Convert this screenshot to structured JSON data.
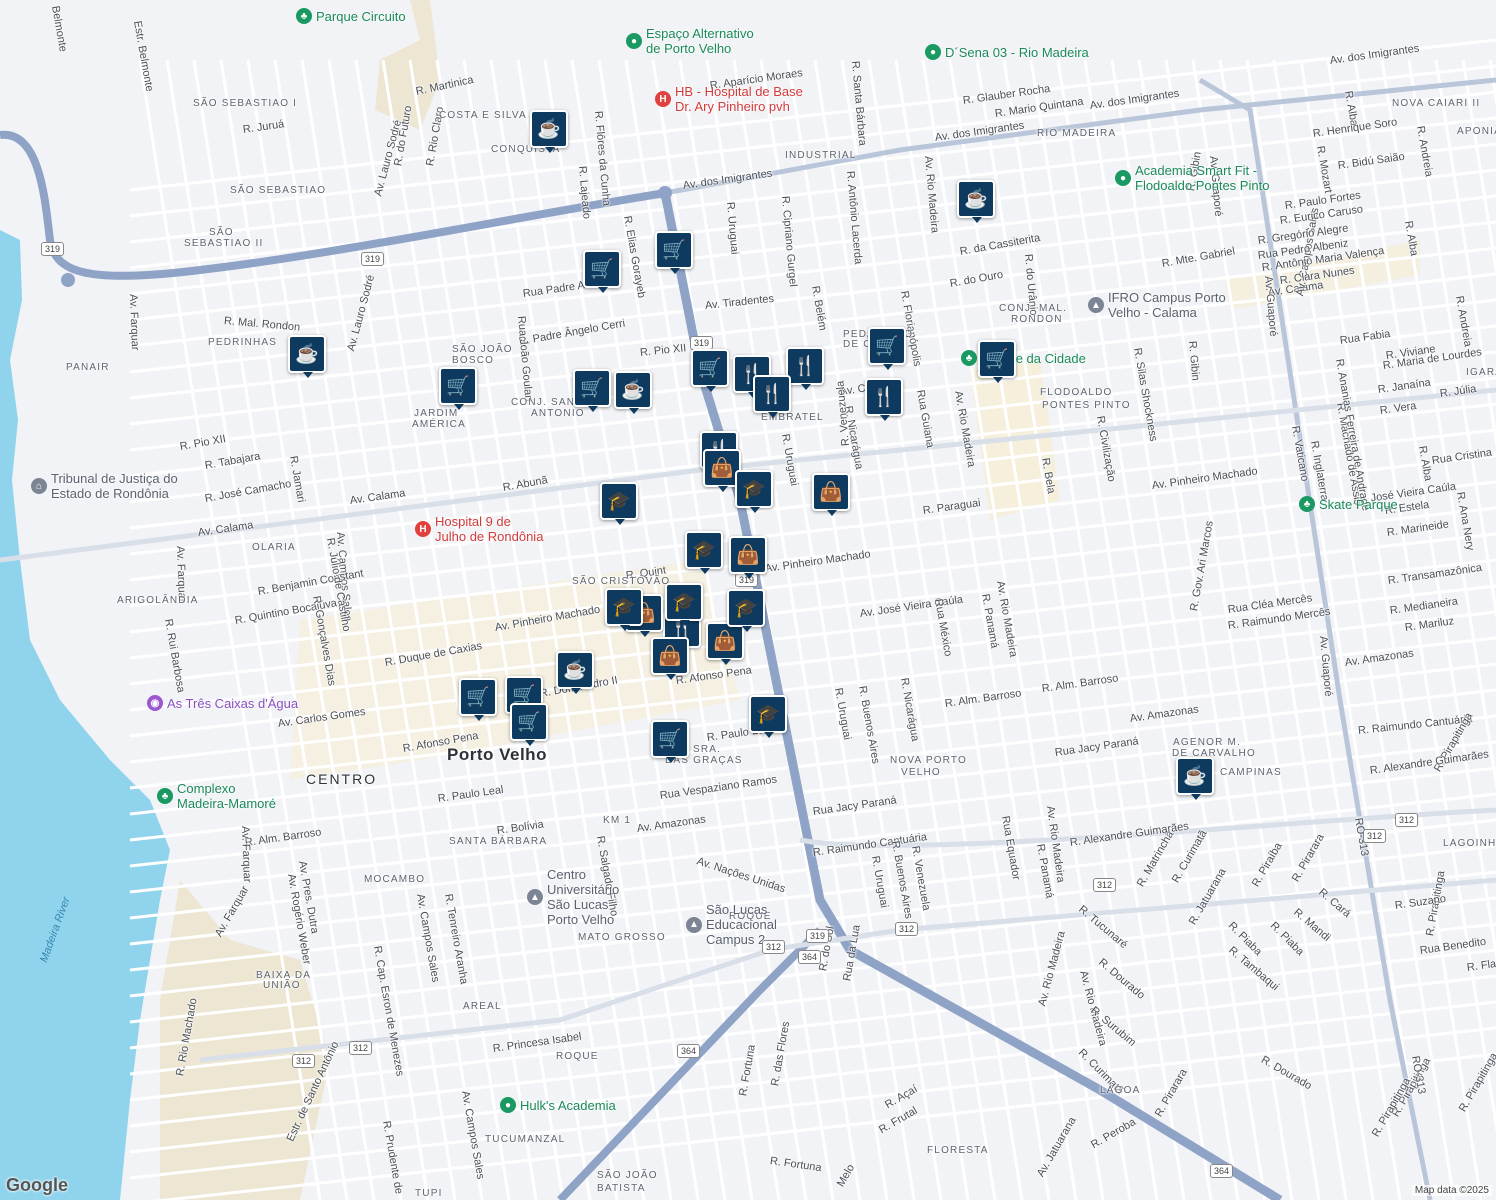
{
  "colors": {
    "background": "#f2f3f6",
    "water": "#8fd3ec",
    "main_road": "#8ea3c6",
    "marker": "#0e3a5f",
    "poi_green": "#1a9a62",
    "poi_red": "#e0413f"
  },
  "streets": [
    {
      "name": "Av. dos Imigrantes"
    },
    {
      "name": "Av. dos Imigrantes"
    },
    {
      "name": "Av. dos Imigrantes"
    },
    {
      "name": "Av. dos Imigrantes"
    },
    {
      "name": "Av. Tiradentes"
    },
    {
      "name": "Av. Calama"
    },
    {
      "name": "Av. Calama"
    },
    {
      "name": "Av. Calama"
    },
    {
      "name": "Av. Calama"
    },
    {
      "name": "Av. Pinheiro Machado"
    },
    {
      "name": "Av. Pinheiro Machado"
    },
    {
      "name": "Av. Pinheiro Machado"
    },
    {
      "name": "Av. José Vieira Caúla"
    },
    {
      "name": "Av. José Vieira Caúla"
    },
    {
      "name": "Av. Amazonas"
    },
    {
      "name": "Av. Amazonas"
    },
    {
      "name": "Av. Amazonas"
    },
    {
      "name": "Av. Carlos Gomes"
    },
    {
      "name": "Av. Nações Unidas"
    },
    {
      "name": "R. Raimundo Cantuária"
    },
    {
      "name": "R. Raimundo Cantuária"
    },
    {
      "name": "R. Alm. Barroso"
    },
    {
      "name": "R. Alm. Barroso"
    },
    {
      "name": "R. Alm. Barroso"
    },
    {
      "name": "Av. Farquar"
    },
    {
      "name": "Av. Farquar"
    },
    {
      "name": "Av. Farquar"
    },
    {
      "name": "Av. Farquar"
    },
    {
      "name": "Av. Lauro Sodré"
    },
    {
      "name": "Av. Lauro Sodré"
    },
    {
      "name": "Av. Campos Sales"
    },
    {
      "name": "Av. Campos Sales"
    },
    {
      "name": "Av. Campos Sales"
    },
    {
      "name": "Av. Rio Madeira"
    },
    {
      "name": "Av. Rio Madeira"
    },
    {
      "name": "Av. Rio Madeira"
    },
    {
      "name": "Av. Rio Madeira"
    },
    {
      "name": "Av. Rio Madeira"
    },
    {
      "name": "Av. Rio Madeira"
    },
    {
      "name": "Av. Guaporé"
    },
    {
      "name": "Av. Guaporé"
    },
    {
      "name": "Av. Guaporé"
    },
    {
      "name": "R. Abunã"
    },
    {
      "name": "R. José Camacho"
    },
    {
      "name": "R. Tabajara"
    },
    {
      "name": "R. Pio XII"
    },
    {
      "name": "R. Pio XII"
    },
    {
      "name": "R. Benjamin Constant"
    },
    {
      "name": "R. Quintino Bocaiúva"
    },
    {
      "name": "R. Duque de Caxias"
    },
    {
      "name": "R. Dom Pedro II"
    },
    {
      "name": "R. Afonso Pena"
    },
    {
      "name": "R. Afonso Pena"
    },
    {
      "name": "R. Paulo Leal"
    },
    {
      "name": "R. Paulo Leal"
    },
    {
      "name": "Rua Vespaziano Ramos"
    },
    {
      "name": "Rua Jacy Paraná"
    },
    {
      "name": "Rua Jacy Paraná"
    },
    {
      "name": "R. Bolívia"
    },
    {
      "name": "R. Mal. Rondon"
    },
    {
      "name": "R. Martinica"
    },
    {
      "name": "R. Juruá"
    },
    {
      "name": "R. Padre Ângelo Cerri"
    },
    {
      "name": "Rua Padre A"
    },
    {
      "name": "R. Aparício Moraes"
    },
    {
      "name": "R. Glauber Rocha"
    },
    {
      "name": "R. Mario Quintana"
    },
    {
      "name": "R. da Cassiterita"
    },
    {
      "name": "R. do Ouro"
    },
    {
      "name": "R. do Urânio"
    },
    {
      "name": "R. Mte. Gabriel"
    },
    {
      "name": "R. Gibin"
    },
    {
      "name": "R. Gibin"
    },
    {
      "name": "R. Uruguai"
    },
    {
      "name": "R. Uruguai"
    },
    {
      "name": "R. Uruguai"
    },
    {
      "name": "R. Uruguai"
    },
    {
      "name": "R. Cipriano Gurgel"
    },
    {
      "name": "R. Antônio Lacerda"
    },
    {
      "name": "R. Santa Bárbara"
    },
    {
      "name": "R. Belém"
    },
    {
      "name": "R. Florianópolis"
    },
    {
      "name": "Rua Guiana"
    },
    {
      "name": "R. Nicarágua"
    },
    {
      "name": "R. Nicarágua"
    },
    {
      "name": "R. Venezuela"
    },
    {
      "name": "R. Venezuela"
    },
    {
      "name": "R. Buenos Aires"
    },
    {
      "name": "R. Buenos Aires"
    },
    {
      "name": "Rua México"
    },
    {
      "name": "R. Panamá"
    },
    {
      "name": "R. Panamá"
    },
    {
      "name": "Rua Equador"
    },
    {
      "name": "R. Paraguai"
    },
    {
      "name": "R. Bela"
    },
    {
      "name": "R. Civilização"
    },
    {
      "name": "R. Silas Shockness"
    },
    {
      "name": "R. Flôres da Cunha"
    },
    {
      "name": "R. Lajeado"
    },
    {
      "name": "R. Elias Gorayeb"
    },
    {
      "name": "Rua João Goulart"
    },
    {
      "name": "R. do Futuro"
    },
    {
      "name": "R. Rio Claro"
    },
    {
      "name": "Estr. Belmonte"
    },
    {
      "name": "Belmonte"
    },
    {
      "name": "R. Jamari"
    },
    {
      "name": "R. Júlio de Castilho"
    },
    {
      "name": "R. Gonçalves Dias"
    },
    {
      "name": "R. Rui Barbosa"
    },
    {
      "name": "Av. Pres. Dutra"
    },
    {
      "name": "Av. Rogério Weber"
    },
    {
      "name": "R. Cap. Esron de Menezes"
    },
    {
      "name": "R. Tenreiro Aranha"
    },
    {
      "name": "R. Salgado Filho"
    },
    {
      "name": "R. Princesa Isabel"
    },
    {
      "name": "Estr. de Santo Antônio"
    },
    {
      "name": "R. Prudente de"
    },
    {
      "name": "R. Rio Machado"
    },
    {
      "name": "Av. Campos Sales"
    },
    {
      "name": "R. das Flores"
    },
    {
      "name": "R. do Sol"
    },
    {
      "name": "Rua da Lua"
    },
    {
      "name": "R. Fortuna"
    },
    {
      "name": "R. Fortuna"
    },
    {
      "name": "R. Açaí"
    },
    {
      "name": "R. Frutal"
    },
    {
      "name": "Melo"
    },
    {
      "name": "Av. Jatuarana"
    },
    {
      "name": "R. Peroba"
    },
    {
      "name": "R. Tucunaré"
    },
    {
      "name": "R. Matrinchã"
    },
    {
      "name": "R. Curimatã"
    },
    {
      "name": "R. Curimatã"
    },
    {
      "name": "R. Jatuarana"
    },
    {
      "name": "R. Piaba"
    },
    {
      "name": "R. Piaba"
    },
    {
      "name": "R. Piraíba"
    },
    {
      "name": "R. Pirarara"
    },
    {
      "name": "R. Pirarara"
    },
    {
      "name": "R. Cará"
    },
    {
      "name": "R. Mandi"
    },
    {
      "name": "R. Tambaqui"
    },
    {
      "name": "R. Dourado"
    },
    {
      "name": "R. Dourado"
    },
    {
      "name": "R. Surubim"
    },
    {
      "name": "R. Pirapitinga"
    },
    {
      "name": "R. Pirapitinga"
    },
    {
      "name": "R. Pirapitinga"
    },
    {
      "name": "R. Pirapitinga"
    },
    {
      "name": "R. Pirapitinga"
    },
    {
      "name": "R. Suzano"
    },
    {
      "name": "Rua Benedito"
    },
    {
      "name": "R. Flame"
    },
    {
      "name": "R. Alba"
    },
    {
      "name": "R. Alba"
    },
    {
      "name": "R. Alba"
    },
    {
      "name": "R. Andreia"
    },
    {
      "name": "R. Andreia"
    },
    {
      "name": "R. Henrique Soro"
    },
    {
      "name": "R. Mozart"
    },
    {
      "name": "R. Bidú Saião"
    },
    {
      "name": "R. Paulo Fortes"
    },
    {
      "name": "R. Eurico Caruso"
    },
    {
      "name": "R. Gregório Alegre"
    },
    {
      "name": "Rua Pedro Albeniz"
    },
    {
      "name": "R. Antônio Maria Valença"
    },
    {
      "name": "R. Clara Nunes"
    },
    {
      "name": "Rua Fabia"
    },
    {
      "name": "R. Viviane"
    },
    {
      "name": "R. Maria de Lourdes"
    },
    {
      "name": "R. Janaína"
    },
    {
      "name": "R. Júlia"
    },
    {
      "name": "R. Vera"
    },
    {
      "name": "R. Machado de Assis"
    },
    {
      "name": "R. Inglaterra"
    },
    {
      "name": "R. Vaticano"
    },
    {
      "name": "R. Ananias Ferreira de Andrade"
    },
    {
      "name": "Rua Cristina"
    },
    {
      "name": "R. Estela"
    },
    {
      "name": "R. Marineide"
    },
    {
      "name": "R. Ana Nery"
    },
    {
      "name": "R. Transamazônica"
    },
    {
      "name": "R. Medianeira"
    },
    {
      "name": "R. Mariluz"
    },
    {
      "name": "Rua Cléa Mercês"
    },
    {
      "name": "R. Raimundo Mercês"
    },
    {
      "name": "R. Gov. Ari Marcos"
    },
    {
      "name": "R. Alexandre Guimarães"
    },
    {
      "name": "R. Alexandre Guimarães"
    },
    {
      "name": "RO-313"
    },
    {
      "name": "RO-313"
    },
    {
      "name": "R. Quint"
    }
  ],
  "neighborhoods": [
    {
      "name": "SÃO SEBASTIAO I"
    },
    {
      "name": "COSTA E SILVA"
    },
    {
      "name": "CONQUISTA"
    },
    {
      "name": "SÃO SEBASTIAO"
    },
    {
      "name": "SÃO"
    },
    {
      "name": "SEBASTIAO II"
    },
    {
      "name": "PEDRINHAS"
    },
    {
      "name": "PANAIR"
    },
    {
      "name": "SÃO JOÃO"
    },
    {
      "name": "BOSCO"
    },
    {
      "name": "CONJ. SANTO"
    },
    {
      "name": "ANTONIO"
    },
    {
      "name": "JARDIM"
    },
    {
      "name": "AMÉRICA"
    },
    {
      "name": "OLARIA"
    },
    {
      "name": "ARIGOLÂNDIA"
    },
    {
      "name": "SÃO CRISTÓVÃO"
    },
    {
      "name": "INDUSTRIAL"
    },
    {
      "name": "RIO MADEIRA"
    },
    {
      "name": "NOVA CAIARI II"
    },
    {
      "name": "APONIÃ"
    },
    {
      "name": "CONJ. MAL."
    },
    {
      "name": "RONDON"
    },
    {
      "name": "PEDACINHO"
    },
    {
      "name": "DE CHÃO"
    },
    {
      "name": "EMBRATEL"
    },
    {
      "name": "FLODOALDO"
    },
    {
      "name": "PONTES PINTO"
    },
    {
      "name": "IGARAPÉ"
    },
    {
      "name": "SRA."
    },
    {
      "name": "DAS GRAÇAS"
    },
    {
      "name": "NOVA PORTO"
    },
    {
      "name": "VELHO"
    },
    {
      "name": "AGENOR M."
    },
    {
      "name": "DE CARVALHO"
    },
    {
      "name": "CAMPINAS"
    },
    {
      "name": "LAGOINHA"
    },
    {
      "name": "SANTA BÁRBARA"
    },
    {
      "name": "MOCAMBO"
    },
    {
      "name": "MATO GROSSO"
    },
    {
      "name": "ROQUE"
    },
    {
      "name": "BAIXA DA"
    },
    {
      "name": "UNIÃO"
    },
    {
      "name": "AREAL"
    },
    {
      "name": "ROQUE"
    },
    {
      "name": "TUCUMANZAL"
    },
    {
      "name": "SÃO JOÃO"
    },
    {
      "name": "BATISTA"
    },
    {
      "name": "TUPI"
    },
    {
      "name": "FLORESTA"
    },
    {
      "name": "LAGOA"
    },
    {
      "name": "KM 1"
    }
  ],
  "city_labels": [
    {
      "name": "Porto Velho"
    },
    {
      "name": "CENTRO"
    }
  ],
  "pois": [
    {
      "name": "Parque Circuito",
      "icon": "tree-icon"
    },
    {
      "name": "Espaço Alternativo",
      "name2": "de Porto Velho",
      "icon": "pin-icon"
    },
    {
      "name": "HB - Hospital de Base",
      "name2": "Dr. Ary Pinheiro pvh",
      "icon": "hospital-icon"
    },
    {
      "name": "D´Sena 03 - Rio Madeira",
      "icon": "pin-icon"
    },
    {
      "name": "Academia Smart Fit -",
      "name2": "Flodoaldo Pontes Pinto",
      "icon": "pin-icon"
    },
    {
      "name": "IFRO Campus Porto",
      "name2": "Velho - Calama",
      "icon": "school-icon"
    },
    {
      "name": "Parque da Cidade",
      "icon": "tree-icon"
    },
    {
      "name": "Tribunal de Justiça do",
      "name2": "Estado de Rondônia",
      "icon": "courthouse-icon"
    },
    {
      "name": "Hospital 9 de",
      "name2": "Julho de Rondônia",
      "icon": "hospital-icon"
    },
    {
      "name": "Skate Parque",
      "icon": "tree-icon"
    },
    {
      "name": "As Três Caixas d'Água",
      "icon": "camera-icon"
    },
    {
      "name": "Complexo",
      "name2": "Madeira-Mamoré",
      "icon": "tree-icon"
    },
    {
      "name": "Centro",
      "name2": "Universitário",
      "name3": "São Lucas",
      "name4": "Porto Velho",
      "icon": "school-icon"
    },
    {
      "name": "São Lucas",
      "name2": "Educacional",
      "name3": "Campus 2",
      "icon": "school-icon"
    },
    {
      "name": "Hulk's Academia",
      "icon": "pin-icon"
    }
  ],
  "highway_shields": [
    "319",
    "319",
    "319",
    "319",
    "319",
    "312",
    "312",
    "312",
    "312",
    "312",
    "312",
    "312",
    "364",
    "364",
    "364"
  ],
  "water_label": "Madeira River",
  "markers": [
    {
      "type": "cafe",
      "icon": "coffee-icon"
    },
    {
      "type": "cafe",
      "icon": "coffee-icon"
    },
    {
      "type": "cafe",
      "icon": "coffee-icon"
    },
    {
      "type": "cafe",
      "icon": "coffee-icon"
    },
    {
      "type": "cafe",
      "icon": "coffee-icon"
    },
    {
      "type": "cafe",
      "icon": "coffee-icon"
    },
    {
      "type": "shop",
      "icon": "cart-icon"
    },
    {
      "type": "shop",
      "icon": "cart-icon"
    },
    {
      "type": "shop",
      "icon": "cart-icon"
    },
    {
      "type": "shop",
      "icon": "cart-icon"
    },
    {
      "type": "shop",
      "icon": "cart-icon"
    },
    {
      "type": "shop",
      "icon": "cart-icon"
    },
    {
      "type": "shop",
      "icon": "cart-icon"
    },
    {
      "type": "shop",
      "icon": "cart-icon"
    },
    {
      "type": "shop",
      "icon": "cart-icon"
    },
    {
      "type": "shop",
      "icon": "cart-icon"
    },
    {
      "type": "shop",
      "icon": "cart-icon"
    },
    {
      "type": "food",
      "icon": "fork-knife-icon"
    },
    {
      "type": "food",
      "icon": "fork-knife-icon"
    },
    {
      "type": "food",
      "icon": "fork-knife-icon"
    },
    {
      "type": "food",
      "icon": "fork-knife-icon"
    },
    {
      "type": "food",
      "icon": "fork-knife-icon"
    },
    {
      "type": "food",
      "icon": "fork-knife-icon"
    },
    {
      "type": "bag",
      "icon": "shopping-bag-icon"
    },
    {
      "type": "bag",
      "icon": "shopping-bag-icon"
    },
    {
      "type": "bag",
      "icon": "shopping-bag-icon"
    },
    {
      "type": "bag",
      "icon": "shopping-bag-icon"
    },
    {
      "type": "bag",
      "icon": "shopping-bag-icon"
    },
    {
      "type": "bag",
      "icon": "shopping-bag-icon"
    },
    {
      "type": "school",
      "icon": "graduation-cap-icon"
    },
    {
      "type": "school",
      "icon": "graduation-cap-icon"
    },
    {
      "type": "school",
      "icon": "graduation-cap-icon"
    },
    {
      "type": "school",
      "icon": "graduation-cap-icon"
    },
    {
      "type": "school",
      "icon": "graduation-cap-icon"
    },
    {
      "type": "school",
      "icon": "graduation-cap-icon"
    },
    {
      "type": "school",
      "icon": "graduation-cap-icon"
    }
  ],
  "branding": {
    "logo": "Google",
    "attribution": "Map data ©2025"
  }
}
